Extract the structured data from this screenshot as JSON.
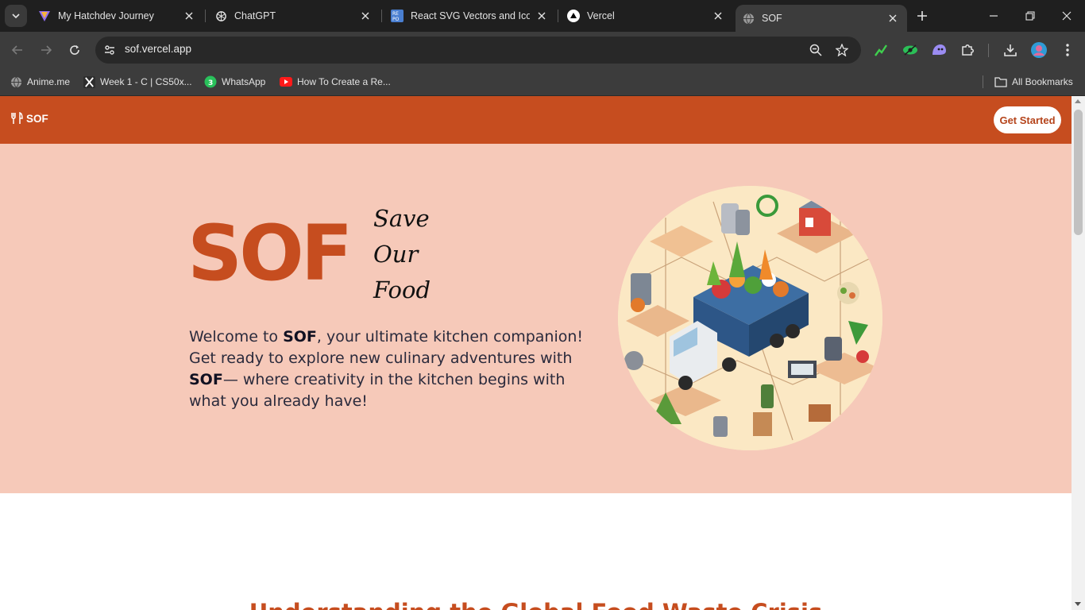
{
  "browser": {
    "tabs": [
      {
        "title": "My Hatchdev Journey",
        "icon": "hatchdev-logo-icon"
      },
      {
        "title": "ChatGPT",
        "icon": "openai-logo-icon"
      },
      {
        "title": "React SVG Vectors and Icons",
        "icon": "repo-logo-icon"
      },
      {
        "title": "Vercel",
        "icon": "vercel-logo-icon"
      },
      {
        "title": "SOF",
        "icon": "globe-icon",
        "active": true
      }
    ],
    "url": "sof.vercel.app",
    "bookmarks": [
      {
        "label": "Anime.me",
        "icon": "globe-icon"
      },
      {
        "label": "Week 1 - C | CS50x...",
        "icon": "x-logo-icon"
      },
      {
        "label": "WhatsApp",
        "icon": "whatsapp-icon",
        "badge": "3"
      },
      {
        "label": "How To Create a Re...",
        "icon": "youtube-icon"
      }
    ],
    "all_bookmarks_label": "All Bookmarks"
  },
  "site": {
    "brand": "SOF",
    "cta_label": "Get Started",
    "hero": {
      "logo": "SOF",
      "slogan": [
        "Save",
        "Our",
        "Food"
      ],
      "intro_1": "Welcome to ",
      "intro_brand_1": "SOF",
      "intro_2": ", your ultimate kitchen companion! Get ready to explore new culinary adventures with ",
      "intro_brand_2": "SOF",
      "intro_3": "— where creativity in the kitchen begins with what you already have!"
    },
    "section_title": "Understanding the Global Food Waste Crisis"
  },
  "colors": {
    "brand": "#c64d1f",
    "hero_bg": "#f6c9b9",
    "chrome_dark": "#1f1f1f",
    "chrome_mid": "#3c3c3c"
  }
}
